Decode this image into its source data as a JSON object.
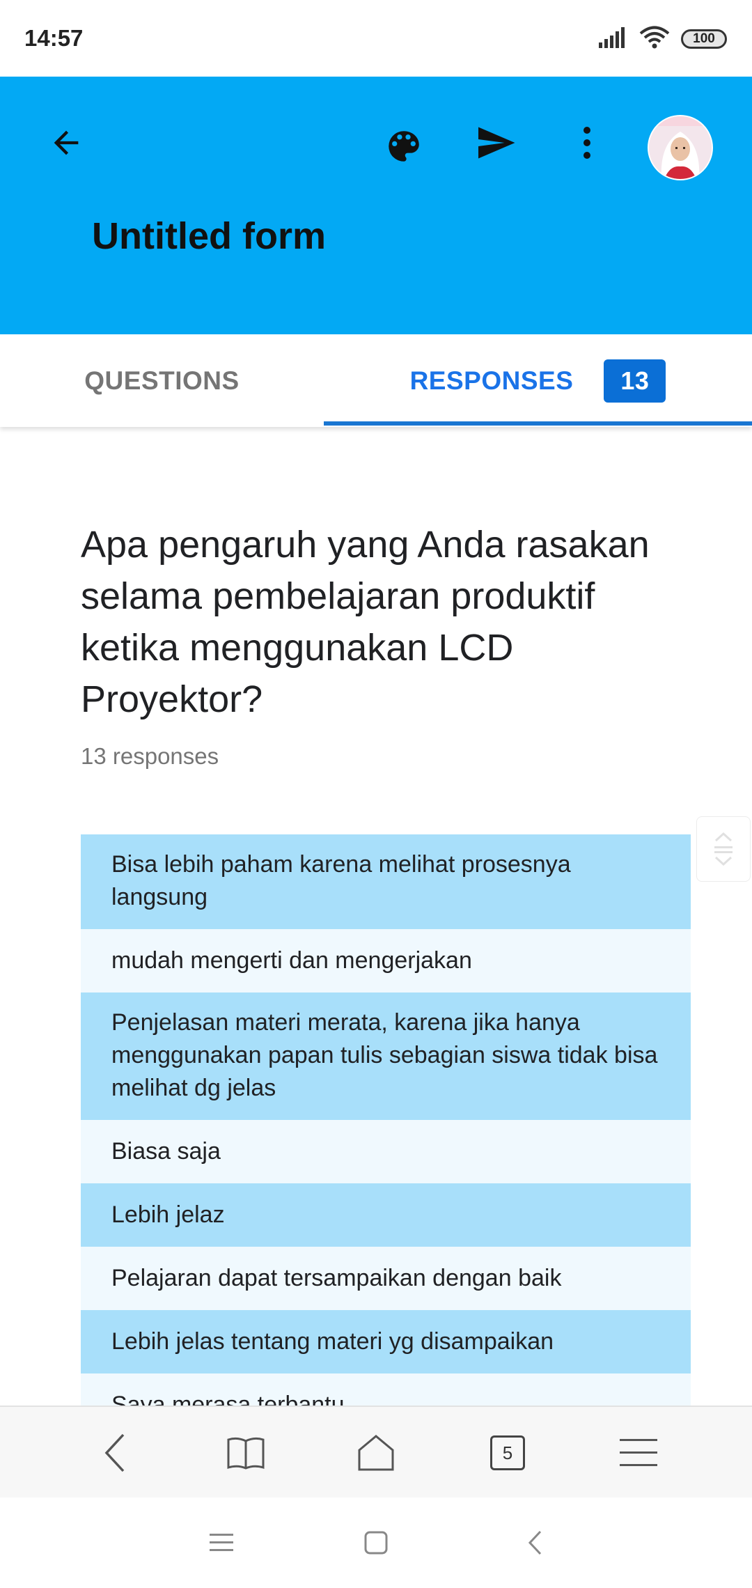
{
  "status_bar": {
    "time": "14:57",
    "battery": "100",
    "icons": [
      "signal-icon",
      "wifi-icon",
      "battery-icon"
    ]
  },
  "header": {
    "title": "Untitled form",
    "background": "#03a9f4",
    "icons": [
      "back-arrow-icon",
      "palette-icon",
      "send-icon",
      "more-vert-icon",
      "avatar"
    ]
  },
  "tabs": {
    "questions_label": "QUESTIONS",
    "responses_label": "RESPONSES",
    "responses_count": "13",
    "active": "RESPONSES",
    "accent": "#1a73e8"
  },
  "question": {
    "text": "Apa pengaruh yang Anda rasakan selama pembelajaran produktif ketika menggunakan LCD Proyektor?",
    "responses_text": "13 responses"
  },
  "responses": [
    "Bisa lebih paham karena melihat prosesnya langsung",
    "mudah mengerti dan mengerjakan",
    "Penjelasan materi merata, karena jika hanya menggunakan papan tulis sebagian siswa tidak bisa melihat dg jelas",
    "Biasa saja",
    "Lebih jelaz",
    "Pelajaran dapat tersampaikan dengan baik",
    "Lebih jelas tentang materi yg disampaikan",
    "Saya merasa terbantu"
  ],
  "browser_bar": {
    "tab_count": "5",
    "icons": [
      "back-icon",
      "book-icon",
      "home-icon",
      "tabs-icon",
      "menu-icon"
    ]
  },
  "nav_bar": {
    "icons": [
      "recents-icon",
      "home-square-icon",
      "back-chevron-icon"
    ]
  }
}
